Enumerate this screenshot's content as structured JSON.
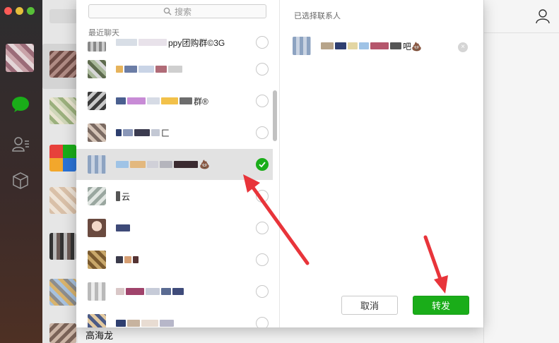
{
  "search": {
    "placeholder": "搜索"
  },
  "section_label": "最近聊天",
  "contacts": [
    {
      "name_suffix": "ppy团购群©3G",
      "selected": false
    },
    {
      "name_suffix": "",
      "selected": false
    },
    {
      "name_suffix": "群®",
      "selected": false
    },
    {
      "name_suffix": "匚",
      "selected": false
    },
    {
      "name_suffix": "💩",
      "selected": true
    },
    {
      "name_suffix": "云",
      "selected": false
    },
    {
      "name_suffix": "",
      "selected": false
    },
    {
      "name_suffix": "",
      "selected": false
    },
    {
      "name_suffix": "",
      "selected": false
    },
    {
      "name_suffix": "",
      "selected": false
    }
  ],
  "selected_panel": {
    "title": "已选择联系人",
    "item_suffix": "吧💩"
  },
  "buttons": {
    "cancel": "取消",
    "send": "转发"
  },
  "background": {
    "bottom_contact_name": "高海龙"
  },
  "colors": {
    "accent_green": "#1aad19",
    "arrow_red": "#e8343a"
  }
}
